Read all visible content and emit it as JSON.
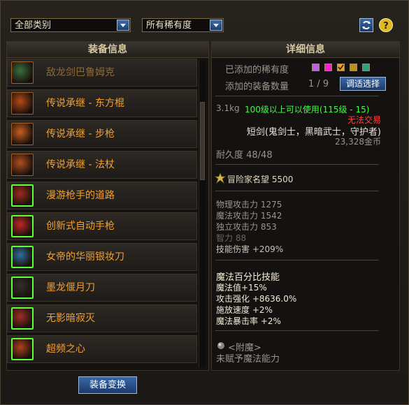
{
  "filters": {
    "category": "全部类别",
    "rarity": "所有稀有度"
  },
  "colors": {
    "item_name": "#f2a030",
    "level": "#3cff3c",
    "tradeable": "#ff4040",
    "title_yellow": "#f8d060"
  },
  "left_panel": {
    "title": "装备信息",
    "items": [
      {
        "name": "敌龙剑巴鲁姆克",
        "icon": "sword-icon"
      },
      {
        "name": "传说承继 - 东方棍",
        "icon": "staff-icon"
      },
      {
        "name": "传说承继 - 步枪",
        "icon": "rifle-icon"
      },
      {
        "name": "传说承继 - 法杖",
        "icon": "wand-icon"
      },
      {
        "name": "漫游枪手的道路",
        "icon": "gun-icon"
      },
      {
        "name": "创新式自动手枪",
        "icon": "pistol-icon"
      },
      {
        "name": "女帝的华丽银妆刀",
        "icon": "blade-icon"
      },
      {
        "name": "墨龙偃月刀",
        "icon": "glaive-icon"
      },
      {
        "name": "无影暗寂灭",
        "icon": "dagger-icon"
      },
      {
        "name": "超频之心",
        "icon": "heart-icon"
      }
    ],
    "button": "装备变换"
  },
  "right_panel": {
    "title": "详细信息",
    "added_rarity_label": "已添加的稀有度",
    "added_count_label": "添加的装备数量",
    "added_count": "1 / 9",
    "adjust_button": "调适选择",
    "rarity_swatches": [
      "#c060e0",
      "#ff20d0",
      "#f0a020",
      "#c09018",
      "#30a080"
    ],
    "weight": "3.1kg",
    "level_req": "100级以上可以使用(115级 - 15)",
    "trade": "无法交易",
    "type": "短剑(鬼剑士，黑暗武士，守护者)",
    "price": "23,328金币",
    "durability": "耐久度 48/48",
    "fame": "冒险家名望 5500",
    "stats": [
      "物理攻击力 1275",
      "魔法攻击力 1542",
      "独立攻击力 853",
      "智力 88",
      "技能伤害 +209%"
    ],
    "skill_title": "魔法百分比技能",
    "skill_stats": [
      " 魔法值+15%",
      "攻击强化 +8636.0%",
      "施放速度 +2%",
      "魔法暴击率 +2%"
    ],
    "enchant_label": "<附魔>",
    "enchant_value": "未赋予魔法能力"
  }
}
